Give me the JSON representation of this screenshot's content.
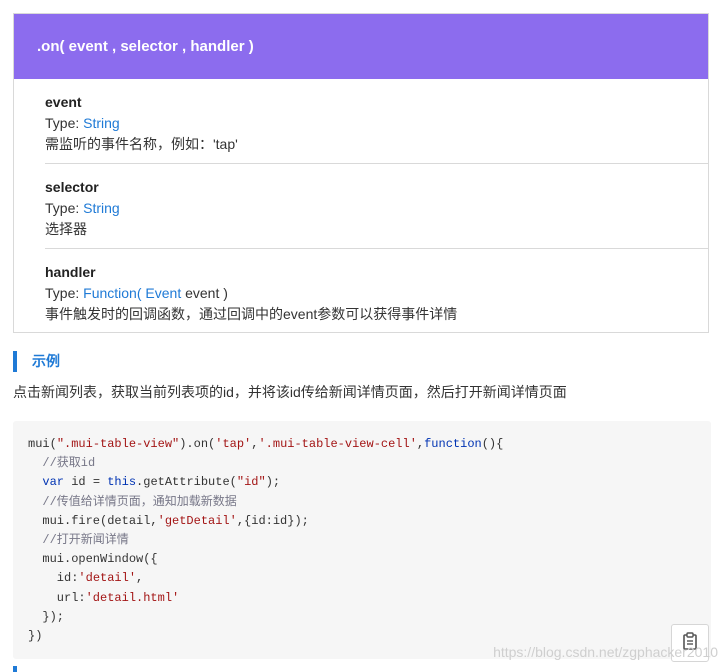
{
  "api": {
    "signature": ".on( event , selector , handler )",
    "params": [
      {
        "name": "event",
        "type_label": "Type: ",
        "type": "String",
        "desc": "需监听的事件名称，例如：'tap'"
      },
      {
        "name": "selector",
        "type_label": "Type: ",
        "type": "String",
        "desc": "选择器"
      },
      {
        "name": "handler",
        "type_label": "Type: ",
        "type": "Function",
        "type_open": "( ",
        "type_arg": "Event",
        "type_rest": " event )",
        "desc": "事件触发时的回调函数，通过回调中的event参数可以获得事件详情"
      }
    ]
  },
  "example": {
    "heading": "示例",
    "description": "点击新闻列表，获取当前列表项的id，并将该id传给新闻详情页面，然后打开新闻详情页面"
  },
  "code": {
    "lines": [
      [
        [
          "p",
          "mui("
        ],
        [
          "s",
          "\".mui-table-view\""
        ],
        [
          "p",
          ").on("
        ],
        [
          "s",
          "'tap'"
        ],
        [
          "p",
          ","
        ],
        [
          "s",
          "'.mui-table-view-cell'"
        ],
        [
          "p",
          ","
        ],
        [
          "k",
          "function"
        ],
        [
          "p",
          "(){"
        ]
      ],
      [
        [
          "p",
          "  "
        ],
        [
          "c",
          "//获取id"
        ]
      ],
      [
        [
          "p",
          "  "
        ],
        [
          "k",
          "var"
        ],
        [
          "p",
          " id = "
        ],
        [
          "k",
          "this"
        ],
        [
          "p",
          ".getAttribute("
        ],
        [
          "s",
          "\"id\""
        ],
        [
          "p",
          ");"
        ]
      ],
      [
        [
          "p",
          "  "
        ],
        [
          "c",
          "//传值给详情页面，通知加载新数据"
        ]
      ],
      [
        [
          "p",
          "  mui.fire(detail,"
        ],
        [
          "s",
          "'getDetail'"
        ],
        [
          "p",
          ",{id:id});"
        ]
      ],
      [
        [
          "p",
          "  "
        ],
        [
          "c",
          "//打开新闻详情"
        ]
      ],
      [
        [
          "p",
          "  mui.openWindow({"
        ]
      ],
      [
        [
          "p",
          "    id:"
        ],
        [
          "s",
          "'detail'"
        ],
        [
          "p",
          ","
        ]
      ],
      [
        [
          "p",
          "    url:"
        ],
        [
          "s",
          "'detail.html'"
        ]
      ],
      [
        [
          "p",
          "  });"
        ]
      ],
      [
        [
          "p",
          "})"
        ]
      ]
    ]
  },
  "icons": {
    "copy": "clipboard-icon"
  },
  "colors": {
    "header": "#8c6cee",
    "accent": "#1f7ad6",
    "code_bg": "#f6f6f6"
  },
  "watermark": "https://blog.csdn.net/zgphacker2010"
}
